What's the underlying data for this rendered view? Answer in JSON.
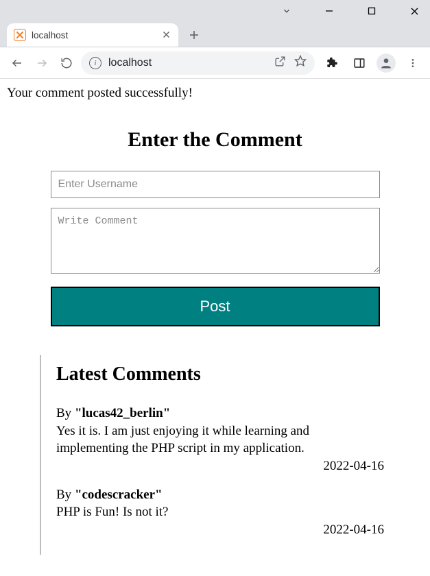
{
  "browser": {
    "tab_title": "localhost",
    "url": "localhost"
  },
  "page": {
    "success_message": "Your comment posted successfully!",
    "form": {
      "title": "Enter the Comment",
      "username_placeholder": "Enter Username",
      "comment_placeholder": "Write Comment",
      "submit_label": "Post"
    },
    "latest": {
      "heading": "Latest Comments",
      "comments": [
        {
          "by_prefix": "By ",
          "username_quoted": "\"lucas42_berlin\"",
          "body": "Yes it is. I am just enjoying it while learning and implementing the PHP script in my application.",
          "date": "2022-04-16"
        },
        {
          "by_prefix": "By ",
          "username_quoted": "\"codescracker\"",
          "body": "PHP is Fun! Is not it?",
          "date": "2022-04-16"
        }
      ]
    }
  }
}
